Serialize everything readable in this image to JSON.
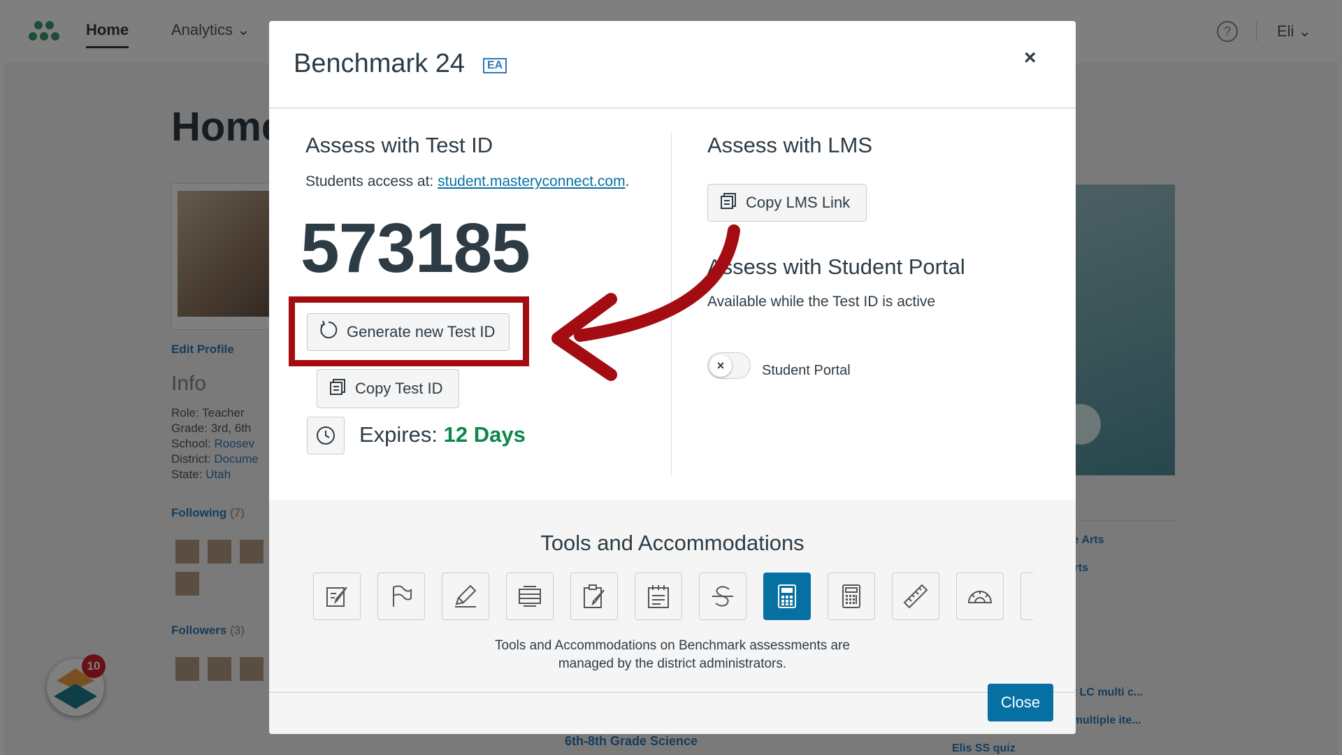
{
  "background": {
    "nav": {
      "home": "Home",
      "analytics": "Analytics",
      "user": "Eli",
      "help": "?"
    },
    "page_title": "Home",
    "edit_profile": "Edit Profile",
    "info_heading": "Info",
    "info": {
      "role_label": "Role:",
      "role": "Teacher",
      "grade_label": "Grade:",
      "grade": "3rd, 6th",
      "school_label": "School:",
      "school": "Roosev",
      "district_label": "District:",
      "district": "Docume",
      "state_label": "State:",
      "state": "Utah"
    },
    "following": "Following",
    "following_count": "(7)",
    "followers": "Followers",
    "followers_count": "(3)",
    "right_links": [
      "ge Arts",
      "Arts",
      "nt LC multi c...",
      "- multiple ite..."
    ],
    "bottom_links": [
      "6th-8th Grade Science",
      "Elis SS quiz"
    ],
    "badge_count": "10"
  },
  "modal": {
    "title": "Benchmark 24",
    "badge": "EA",
    "close_icon": "×",
    "test_id_section": {
      "title": "Assess with Test ID",
      "access_prefix": "Students access at:",
      "access_link": "student.masteryconnect.com",
      "access_suffix": ".",
      "test_id": "573185",
      "generate_button": "Generate new Test ID",
      "copy_button": "Copy Test ID",
      "expires_label": "Expires:",
      "expires_value": "12 Days"
    },
    "lms_section": {
      "title": "Assess with LMS",
      "copy_button": "Copy LMS Link"
    },
    "portal_section": {
      "title": "Assess with Student Portal",
      "subtitle": "Available while the Test ID is active",
      "toggle_label": "Student Portal",
      "toggle_state": "off"
    },
    "tools": {
      "title": "Tools and Accommodations",
      "icons": [
        "edit-note-icon",
        "flag-icon",
        "highlighter-icon",
        "line-reader-icon",
        "clipboard-edit-icon",
        "notepad-icon",
        "strikethrough-icon",
        "basic-calculator-icon",
        "scientific-calculator-icon",
        "ruler-icon",
        "protractor-icon",
        "partial-tool-icon"
      ],
      "active_icon": "basic-calculator-icon",
      "note_line1": "Tools and Accommodations on Benchmark assessments are",
      "note_line2": "managed by the district administrators."
    },
    "close_button": "Close"
  },
  "annotation": {
    "color": "#a30d12"
  },
  "colors": {
    "primary": "#0770a3",
    "success": "#0b874b",
    "text": "#2d3b45"
  }
}
